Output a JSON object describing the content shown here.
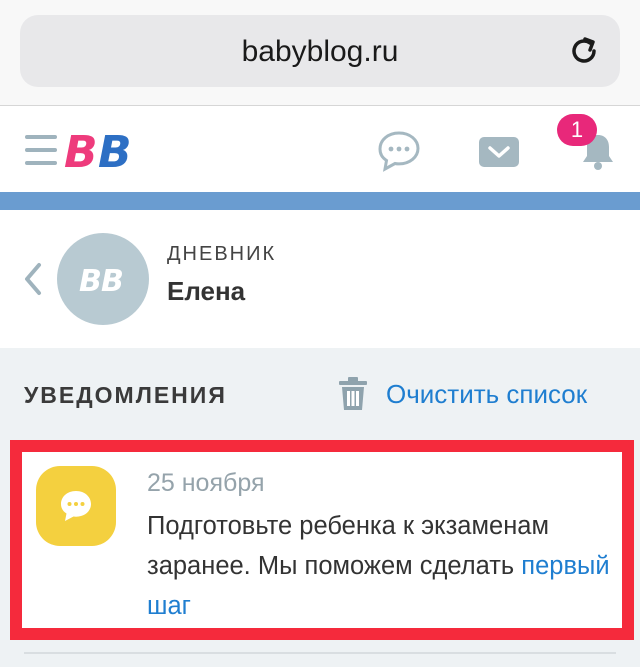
{
  "browser": {
    "url": "babyblog.ru"
  },
  "header": {
    "logo_text": "BB",
    "notifications_count": "1"
  },
  "diary": {
    "label": "ДНЕВНИК",
    "name": "Елена",
    "avatar_text": "BB"
  },
  "notifications": {
    "title": "УВЕДОМЛЕНИЯ",
    "clear_label": "Очистить список",
    "items": [
      {
        "date": "25 ноября",
        "text": "Подготовьте ребенка к экзаменам заранее. Мы поможем сделать ",
        "link": "первый шаг"
      }
    ]
  },
  "colors": {
    "accent_blue": "#1f7ed0",
    "badge_pink": "#e8287a",
    "highlight_red": "#f52a3c",
    "icon_yellow": "#f4d03f"
  },
  "icons": [
    "reload-icon",
    "menu-icon",
    "logo",
    "chat-icon",
    "mail-icon",
    "bell-icon",
    "back-chevron-icon",
    "trash-icon",
    "chat-bubble-icon"
  ]
}
